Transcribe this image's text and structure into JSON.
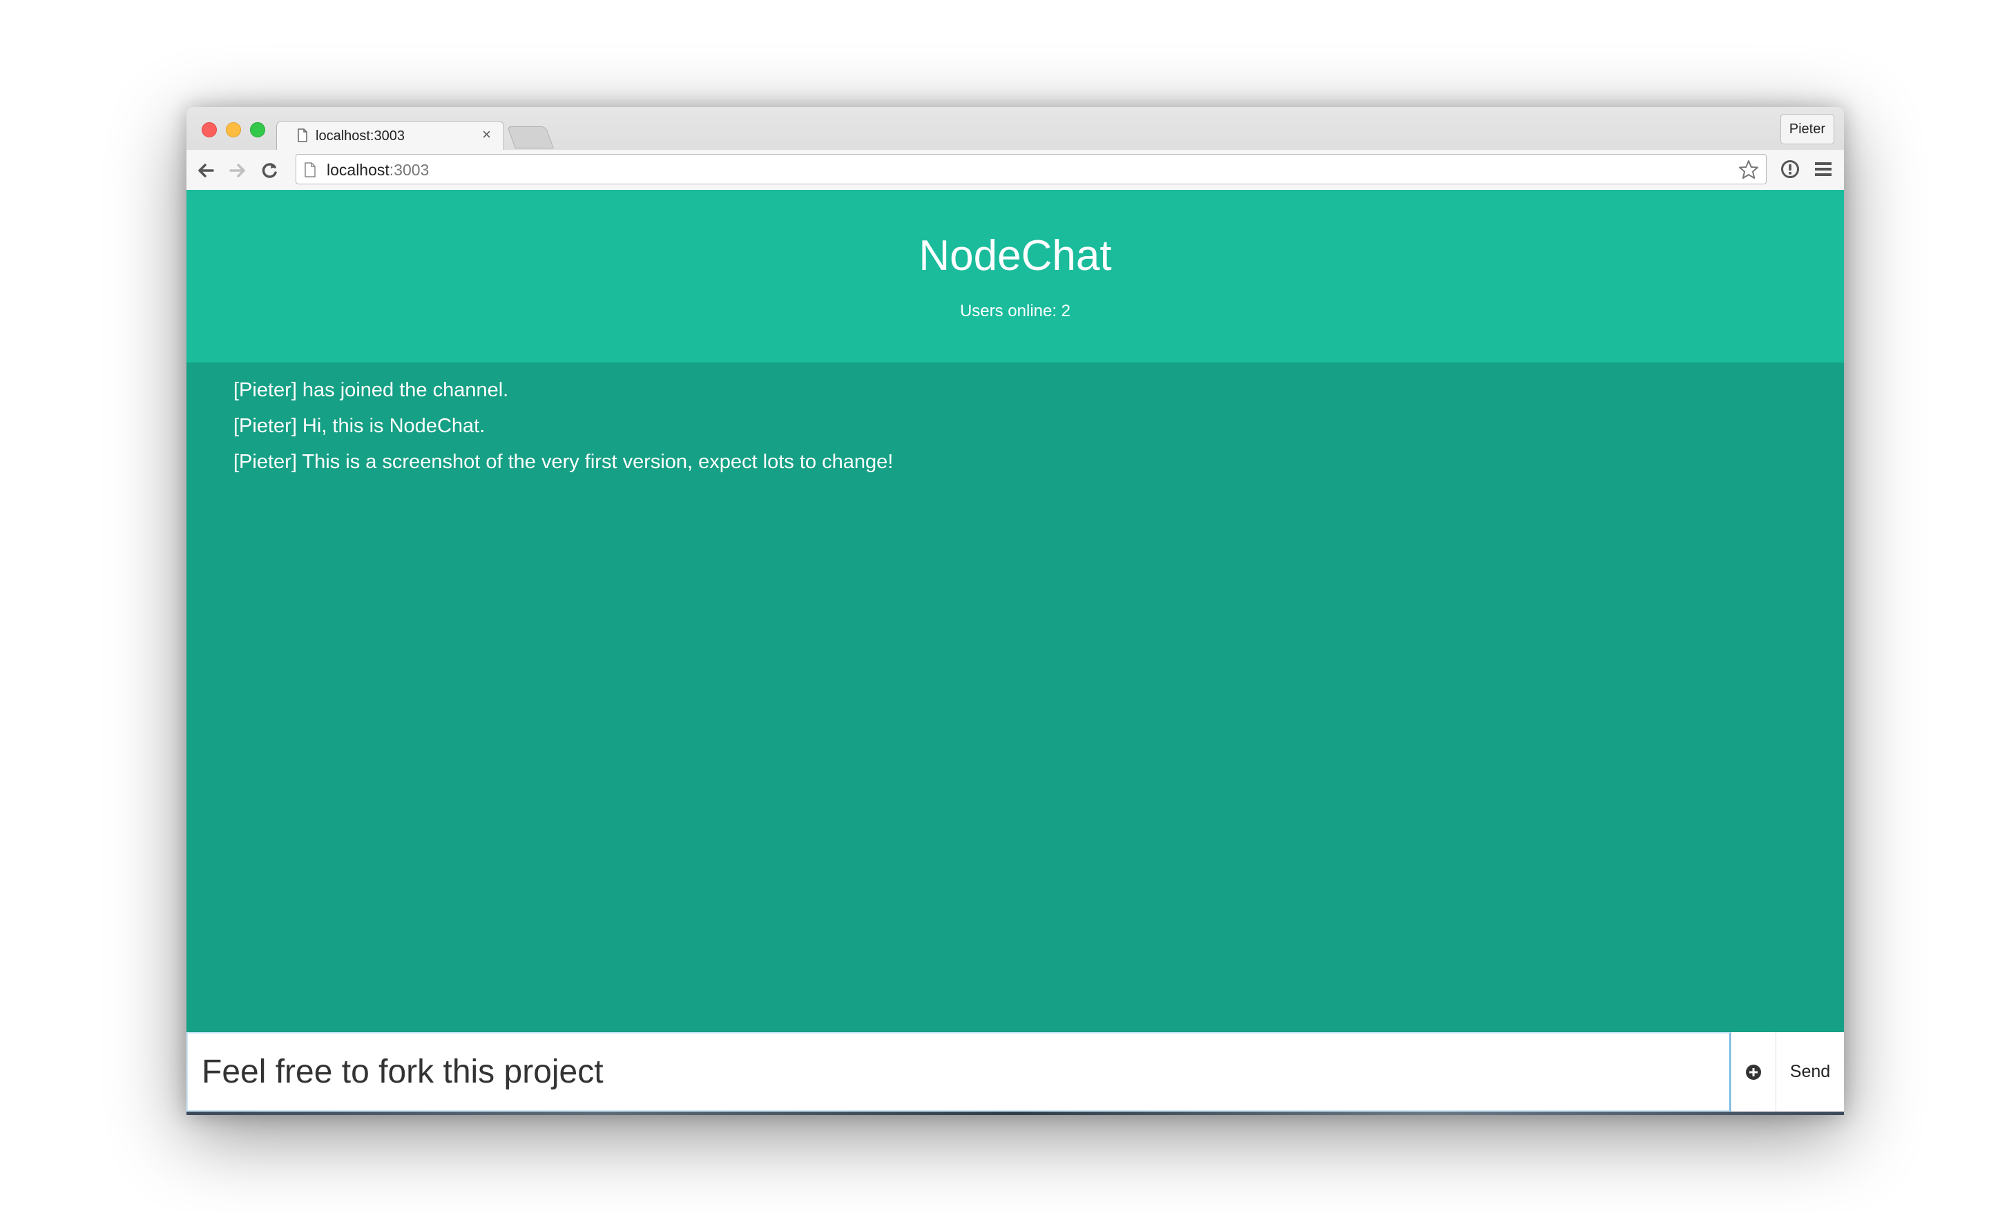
{
  "browser": {
    "tab_title": "localhost:3003",
    "tab_close": "×",
    "profile_name": "Pieter",
    "url_host": "localhost",
    "url_port": ":3003"
  },
  "app": {
    "title": "NodeChat",
    "users_online": "Users online: 2",
    "messages": [
      {
        "text": "[Pieter] has joined the channel."
      },
      {
        "text": "[Pieter] Hi, this is NodeChat."
      },
      {
        "text": "[Pieter] This is a screenshot of the very first version, expect lots to change!"
      }
    ],
    "input_value": "Feel free to fork this project",
    "send_label": "Send",
    "colors": {
      "header": "#1abc9c",
      "messages_bg": "#16a085"
    }
  },
  "icons": {
    "attach": "plus-circle-icon",
    "back": "arrow-left-icon",
    "forward": "arrow-right-icon",
    "reload": "reload-icon",
    "bookmark": "star-icon",
    "extension": "info-icon",
    "menu": "hamburger-menu-icon",
    "page": "document-icon"
  }
}
